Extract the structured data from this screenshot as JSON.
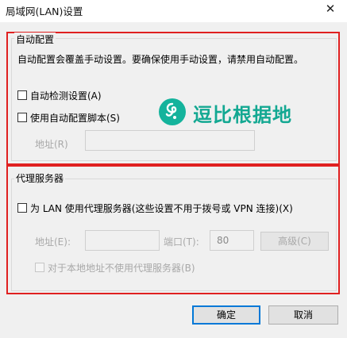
{
  "window": {
    "title": "局域网(LAN)设置",
    "close_glyph": "✕"
  },
  "auto_config": {
    "group_label": "自动配置",
    "description": "自动配置会覆盖手动设置。要确保使用手动设置，请禁用自动配置。",
    "auto_detect_label": "自动检测设置(A)",
    "use_script_label": "使用自动配置脚本(S)",
    "address_label": "地址(R)",
    "address_value": ""
  },
  "watermark": {
    "text": "逗比根据地",
    "color": "#13a892",
    "icon": "logo-swirl-icon"
  },
  "proxy": {
    "group_label": "代理服务器",
    "use_proxy_label": "为 LAN 使用代理服务器(这些设置不用于拨号或 VPN 连接)(X)",
    "address_label": "地址(E):",
    "address_value": "",
    "port_label": "端口(T):",
    "port_value": "80",
    "advanced_label": "高级(C)",
    "bypass_local_label": "对于本地地址不使用代理服务器(B)"
  },
  "buttons": {
    "ok_label": "确定",
    "cancel_label": "取消"
  },
  "colors": {
    "highlight_border": "#e02020",
    "accent": "#0078d7"
  }
}
